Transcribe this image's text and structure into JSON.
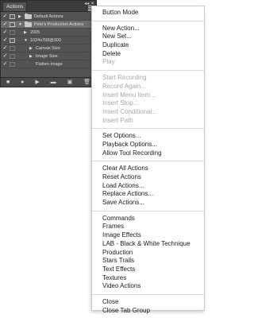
{
  "panel": {
    "tab_label": "Actions",
    "top_controls": "◂◂ ✕",
    "rows": [
      {
        "label": "Default Actions",
        "kind": "set",
        "expanded": false,
        "checked": true,
        "dialog": true,
        "selected": false
      },
      {
        "label": "Pete's Production Actions",
        "kind": "set",
        "expanded": true,
        "checked": true,
        "dialog": true,
        "selected": true
      },
      {
        "label": "2005",
        "kind": "action",
        "expanded": false,
        "checked": true,
        "dialog": false,
        "selected": false
      },
      {
        "label": "1024x768@300",
        "kind": "action",
        "expanded": true,
        "checked": true,
        "dialog": true,
        "selected": false
      },
      {
        "label": "Canvas Size",
        "kind": "step",
        "expanded": false,
        "checked": true,
        "dialog": false,
        "selected": false
      },
      {
        "label": "Image Size",
        "kind": "step",
        "expanded": false,
        "checked": true,
        "dialog": false,
        "selected": false
      },
      {
        "label": "Flatten Image",
        "kind": "step-leaf",
        "expanded": false,
        "checked": true,
        "dialog": false,
        "selected": false
      }
    ],
    "footer_icons": [
      "stop-icon",
      "record-icon",
      "play-icon",
      "new-set-icon",
      "new-action-icon",
      "delete-icon"
    ],
    "footer_glyphs": [
      "■",
      "●",
      "▶",
      "▬",
      "▣",
      "🗑"
    ]
  },
  "menu": {
    "groups": [
      [
        {
          "label": "Button Mode",
          "enabled": true
        }
      ],
      [
        {
          "label": "New Action...",
          "enabled": true
        },
        {
          "label": "New Set...",
          "enabled": true
        },
        {
          "label": "Duplicate",
          "enabled": true
        },
        {
          "label": "Delete",
          "enabled": true
        },
        {
          "label": "Play",
          "enabled": false
        }
      ],
      [
        {
          "label": "Start Recording",
          "enabled": false
        },
        {
          "label": "Record Again...",
          "enabled": false
        },
        {
          "label": "Insert Menu Item...",
          "enabled": false
        },
        {
          "label": "Insert Stop...",
          "enabled": false
        },
        {
          "label": "Insert Conditional...",
          "enabled": false
        },
        {
          "label": "Insert Path",
          "enabled": false
        }
      ],
      [
        {
          "label": "Set Options...",
          "enabled": true
        },
        {
          "label": "Playback Options...",
          "enabled": true
        },
        {
          "label": "Allow Tool Recording",
          "enabled": true
        }
      ],
      [
        {
          "label": "Clear All Actions",
          "enabled": true
        },
        {
          "label": "Reset Actions",
          "enabled": true
        },
        {
          "label": "Load Actions...",
          "enabled": true
        },
        {
          "label": "Replace Actions...",
          "enabled": true
        },
        {
          "label": "Save Actions...",
          "enabled": true
        }
      ],
      [
        {
          "label": "Commands",
          "enabled": true
        },
        {
          "label": "Frames",
          "enabled": true
        },
        {
          "label": "Image Effects",
          "enabled": true
        },
        {
          "label": "LAB - Black & White Technique",
          "enabled": true
        },
        {
          "label": "Production",
          "enabled": true
        },
        {
          "label": "Stars Trails",
          "enabled": true
        },
        {
          "label": "Text Effects",
          "enabled": true
        },
        {
          "label": "Textures",
          "enabled": true
        },
        {
          "label": "Video Actions",
          "enabled": true
        }
      ],
      [
        {
          "label": "Close",
          "enabled": true
        },
        {
          "label": "Close Tab Group",
          "enabled": true
        }
      ]
    ]
  }
}
